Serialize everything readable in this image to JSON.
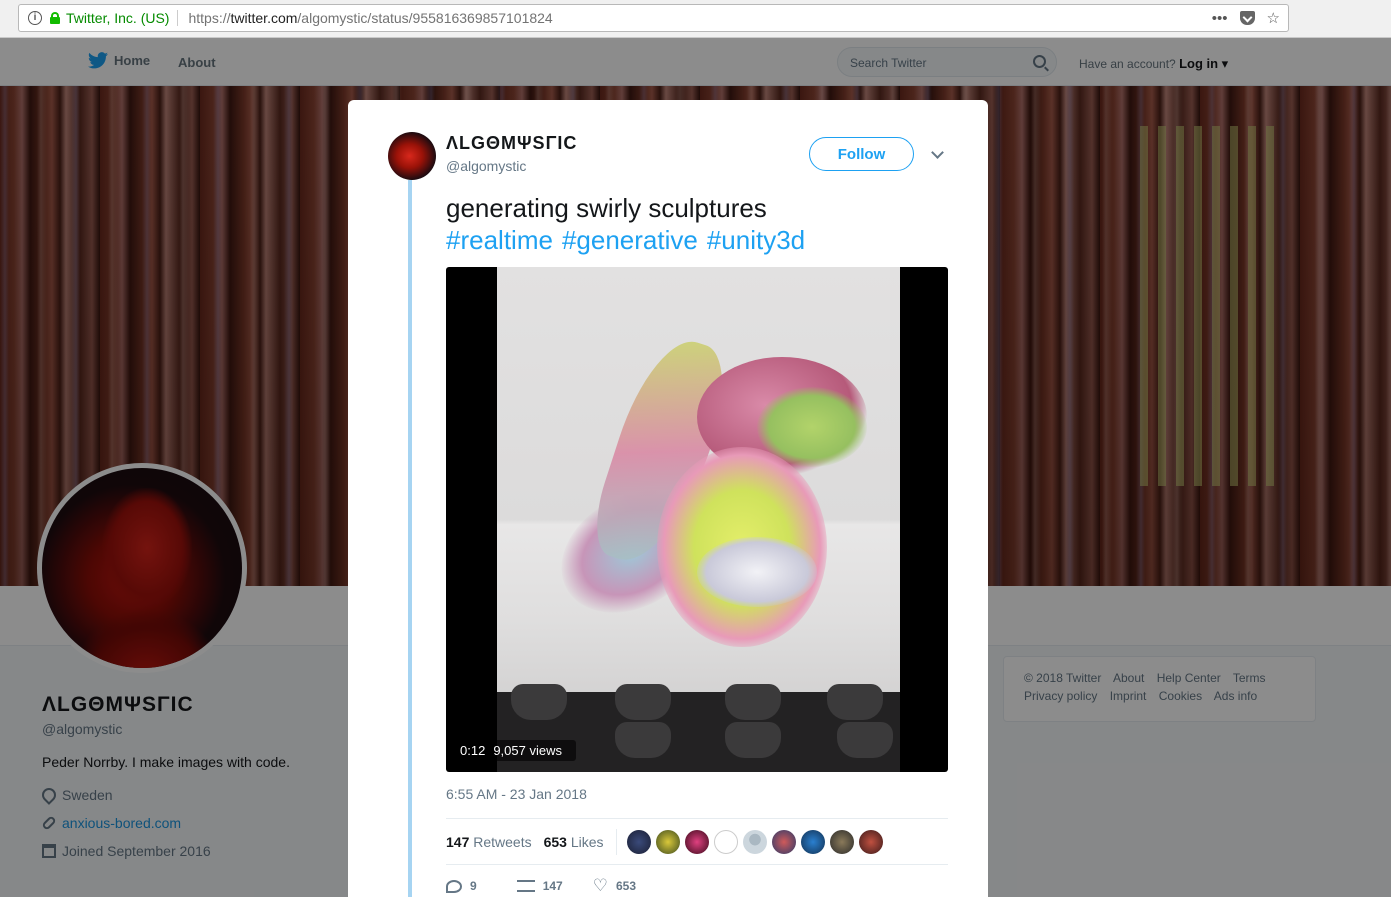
{
  "browser": {
    "identity": "Twitter, Inc. (US)",
    "url_prefix": "https://",
    "url_domain": "twitter.com",
    "url_path": "/algomystic/status/955816369857101824",
    "more_label": "•••"
  },
  "nav": {
    "home": "Home",
    "about": "About",
    "search_placeholder": "Search Twitter",
    "have_account": "Have an account?",
    "login": "Log in ▾"
  },
  "profile": {
    "display_name": "ΛLGΘMΨSΓIC",
    "handle": "@algomystic",
    "bio": "Peder Norrby. I make images with code.",
    "location": "Sweden",
    "website": "anxious-bored.com",
    "joined": "Joined September 2016"
  },
  "footer": {
    "links": [
      "© 2018 Twitter",
      "About",
      "Help Center",
      "Terms",
      "Privacy policy",
      "Imprint",
      "Cookies",
      "Ads info"
    ]
  },
  "tweet": {
    "display_name": "ΛLGΘMΨSΓIC",
    "handle": "@algomystic",
    "follow_label": "Follow",
    "text": "generating swirly sculptures",
    "hashtags": [
      "#realtime",
      "#generative",
      "#unity3d"
    ],
    "video_duration": "0:12",
    "video_views": "9,057 views",
    "timestamp": "6:55 AM - 23 Jan 2018",
    "retweets_count": "147",
    "retweets_label": "Retweets",
    "likes_count": "653",
    "likes_label": "Likes",
    "reply_count": "9",
    "retweet_action_count": "147",
    "like_action_count": "653"
  },
  "colors": {
    "accent": "#1da1f2",
    "thread_line": "#a6d4f2",
    "secure_green": "#12bc00"
  }
}
